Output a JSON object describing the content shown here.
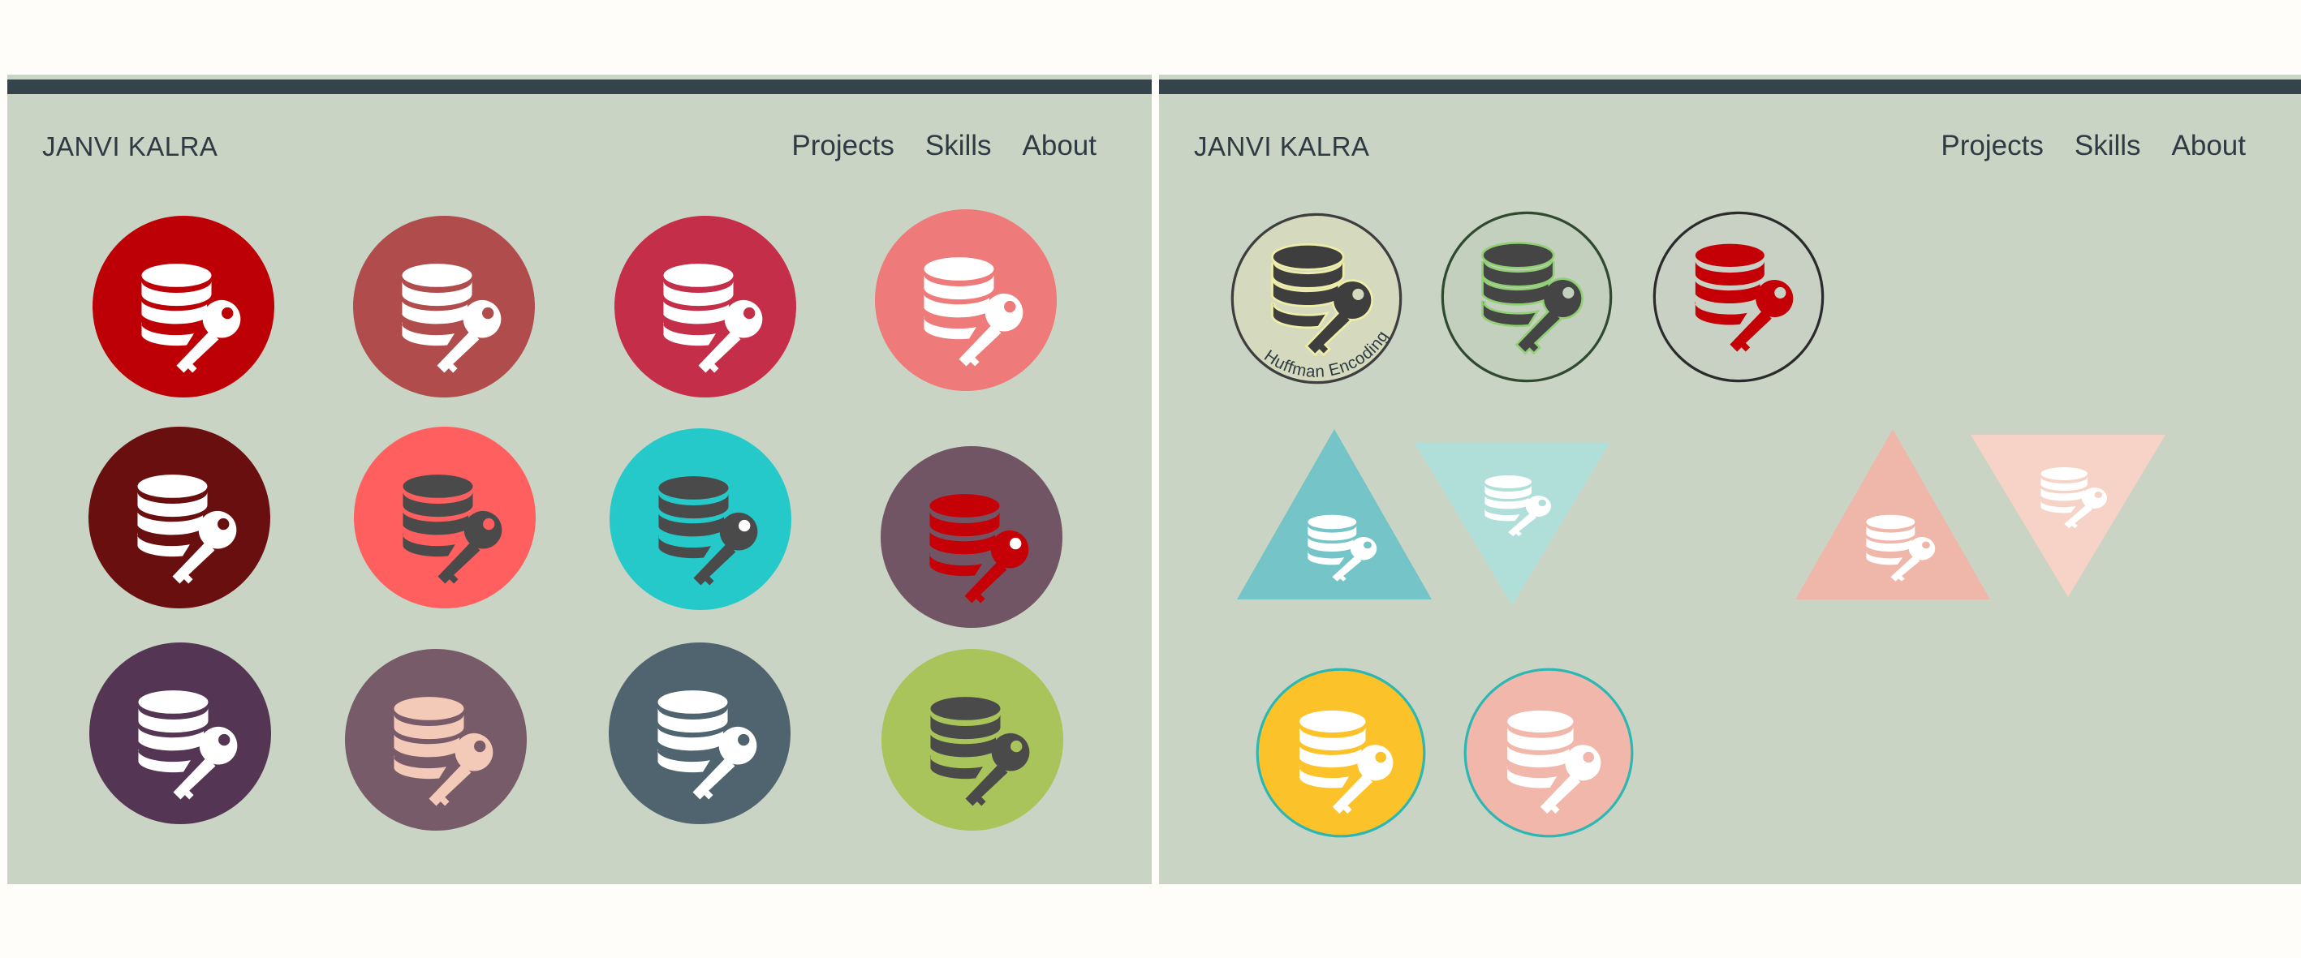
{
  "brand": "JANVI KALRA",
  "nav": [
    "Projects",
    "Skills",
    "About"
  ],
  "caption": "Huffman Encoding",
  "icon_name": "database-key-icon",
  "left_icons": [
    {
      "bg": "#bd0005",
      "fg": "#ffffff",
      "key": "#ffffff",
      "hole": "#bd0005"
    },
    {
      "bg": "#b04c4c",
      "fg": "#ffffff",
      "key": "#ffffff",
      "hole": "#b04c4c"
    },
    {
      "bg": "#c42e48",
      "fg": "#ffffff",
      "key": "#ffffff",
      "hole": "#c42e48"
    },
    {
      "bg": "#ef7a7a",
      "fg": "#ffffff",
      "key": "#ffffff",
      "hole": "#ef7a7a"
    },
    {
      "bg": "#6a0f10",
      "fg": "#ffffff",
      "key": "#ffffff",
      "hole": "#6a0f10"
    },
    {
      "bg": "#ff5f5f",
      "fg": "#4a4a4a",
      "key": "#4a4a4a",
      "hole": "#ff5f5f"
    },
    {
      "bg": "#26c9c9",
      "fg": "#4a4a4a",
      "key": "#4a4a4a",
      "hole": "#ffffff"
    },
    {
      "bg": "#725564",
      "fg": "#c60007",
      "key": "#c60007",
      "hole": "#ffffff"
    },
    {
      "bg": "#543654",
      "fg": "#ffffff",
      "key": "#ffffff",
      "hole": "#543654"
    },
    {
      "bg": "#775b69",
      "fg": "#f3c9b8",
      "key": "#f3c9b8",
      "hole": "#775b69"
    },
    {
      "bg": "#4f646e",
      "fg": "#ffffff",
      "key": "#ffffff",
      "hole": "#4f646e"
    },
    {
      "bg": "#a9c45a",
      "fg": "#4a4a4a",
      "key": "#4a4a4a",
      "hole": "#a9c45a"
    }
  ],
  "right_row1": [
    {
      "bg": "#d5d9bd",
      "ring": "#3e3e3e",
      "fg": "#3e3e3e",
      "glow": "#f1f1a8",
      "captioned": true
    },
    {
      "bg": "#c3d0bd",
      "ring": "#2f4a2f",
      "fg": "#454545",
      "glow": "#8ccf6e",
      "captioned": false
    },
    {
      "bg": "#c9d1c4",
      "ring": "#2b2b2b",
      "fg": "#c40006",
      "glow": "#c9d1c4",
      "captioned": false
    }
  ],
  "right_triangles": [
    {
      "bg": "#74c4c8",
      "fg": "#ffffff",
      "dir": "up"
    },
    {
      "bg": "#b0dfd9",
      "fg": "#ffffff",
      "dir": "down"
    },
    {
      "bg": "#efb7a9",
      "fg": "#ffffff",
      "dir": "up"
    },
    {
      "bg": "#f6d3c6",
      "fg": "#ffffff",
      "dir": "down"
    }
  ],
  "right_row3": [
    {
      "bg": "#fcc22a",
      "ring": "#2bb7b3",
      "fg": "#ffffff"
    },
    {
      "bg": "#f0b7aa",
      "ring": "#2bb7b3",
      "fg": "#ffffff"
    }
  ]
}
